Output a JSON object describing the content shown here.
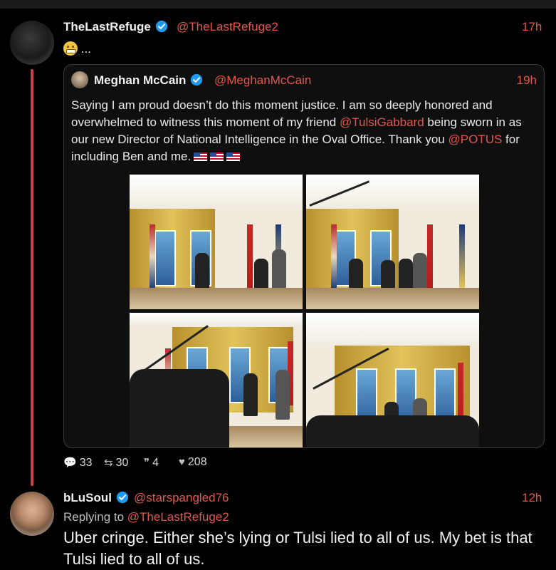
{
  "tweet1": {
    "name": "TheLastRefuge",
    "handle": "@TheLastRefuge2",
    "time": "17h",
    "text": "...",
    "emoji": "grimacing-face"
  },
  "quote": {
    "name": "Meghan McCain",
    "handle": "@MeghanMcCain",
    "time": "19h",
    "text_1": "Saying I am proud doesn’t do this moment justice. I am so deeply honored and overwhelmed to witness this moment of my friend ",
    "mention_1": "@TulsiGabbard",
    "text_2": " being sworn in as our new Director of National Intelligence in the Oval Office. Thank you ",
    "mention_2": "@POTUS",
    "text_3": " for including Ben and me.",
    "flags": [
      "us-flag",
      "us-flag",
      "us-flag"
    ]
  },
  "stats": {
    "replies": "33",
    "retweets": "30",
    "quotes": "4",
    "likes": "208"
  },
  "tweet3": {
    "name": "bLuSoul",
    "handle": "@starspangled76",
    "time": "12h",
    "replying_prefix": "Replying to ",
    "replying_to": "@TheLastRefuge2",
    "text": "Uber cringe.  Either she’s lying or Tulsi lied to all of us.  My bet is that Tulsi lied to all of us."
  },
  "colors": {
    "accent": "#e2574c",
    "thread_line": "#c94045",
    "verified": "#1d9bf0",
    "background": "#000000"
  }
}
